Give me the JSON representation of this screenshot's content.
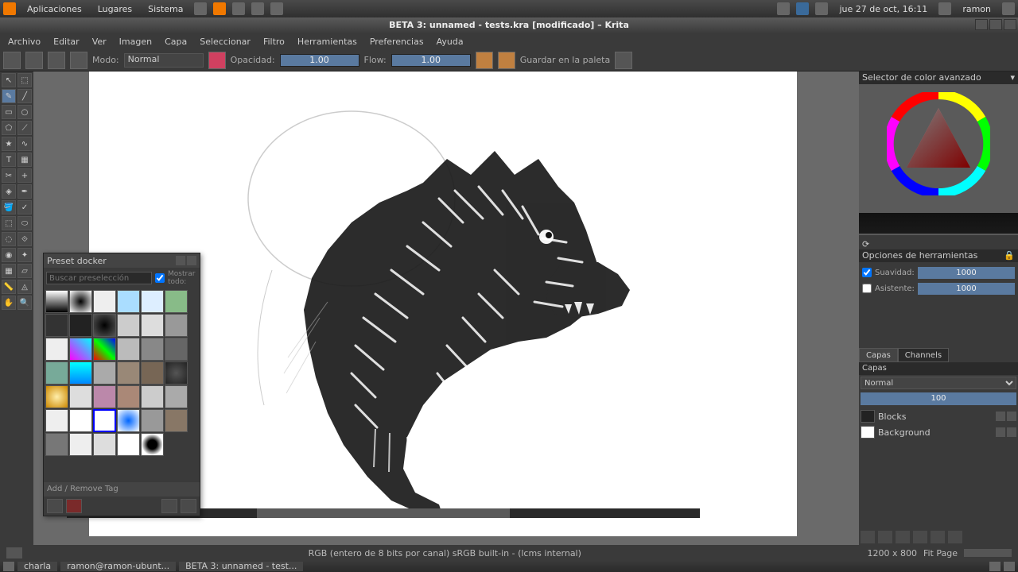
{
  "sysbar": {
    "apps": "Aplicaciones",
    "places": "Lugares",
    "system": "Sistema",
    "date": "jue 27 de oct, 16:11",
    "user": "ramon"
  },
  "titlebar": {
    "title": "BETA 3: unnamed - tests.kra [modificado] – Krita"
  },
  "menubar": {
    "archivo": "Archivo",
    "editar": "Editar",
    "ver": "Ver",
    "imagen": "Imagen",
    "capa": "Capa",
    "seleccionar": "Seleccionar",
    "filtro": "Filtro",
    "herramientas": "Herramientas",
    "preferencias": "Preferencias",
    "ayuda": "Ayuda"
  },
  "toolbar": {
    "modo": "Modo:",
    "modo_value": "Normal",
    "opacidad": "Opacidad:",
    "opacidad_value": "1.00",
    "flow": "Flow:",
    "flow_value": "1.00",
    "guardar": "Guardar en la paleta"
  },
  "preset_docker": {
    "title": "Preset docker",
    "search_placeholder": "Buscar preselección",
    "mostrar_todo": "Mostrar todo:",
    "add_tag": "Add / Remove Tag"
  },
  "color_panel": {
    "title": "Selector de color avanzado"
  },
  "tool_options": {
    "title": "Opciones de herramientas",
    "suavidad": "Suavidad:",
    "suavidad_value": "1000",
    "asistente": "Asistente:",
    "asistente_value": "1000"
  },
  "layers": {
    "tab_capas": "Capas",
    "tab_channels": "Channels",
    "header": "Capas",
    "mode": "Normal",
    "opacity": "100",
    "layer1": "Blocks",
    "layer2": "Background"
  },
  "statusbar": {
    "colorspace": "RGB (entero de 8 bits por canal)  sRGB built-in - (lcms internal)",
    "dimensions": "1200 x 800",
    "zoom": "Fit Page"
  },
  "taskbar": {
    "item1": "charla",
    "item2": "ramon@ramon-ubunt...",
    "item3": "BETA 3: unnamed - test..."
  }
}
